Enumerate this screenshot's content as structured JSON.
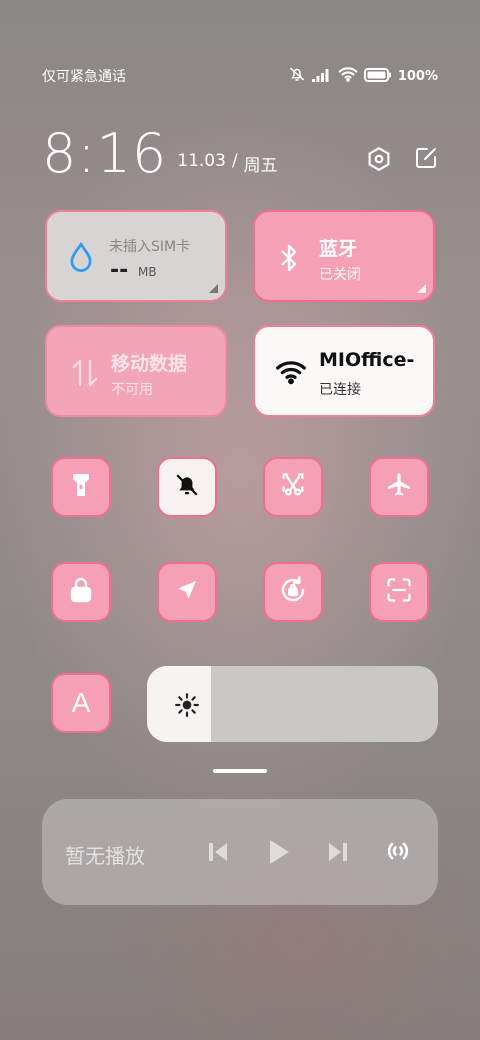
{
  "status_bar": {
    "carrier": "仅可紧急通话",
    "battery": "100%",
    "icons": [
      "mute-icon",
      "signal-icon",
      "wifi-icon",
      "battery-icon"
    ]
  },
  "header": {
    "time": "8:16",
    "date": "11.03",
    "separator": "/",
    "weekday": "周五",
    "icons": [
      "settings-icon",
      "edit-icon"
    ]
  },
  "tiles": {
    "data_usage": {
      "title": "未插入SIM卡",
      "value": "--",
      "unit": "MB",
      "icon": "drop-icon"
    },
    "bluetooth": {
      "title": "蓝牙",
      "status": "已关闭",
      "icon": "bluetooth-icon"
    },
    "mobile_data": {
      "title": "移动数据",
      "status": "不可用",
      "icon": "data-arrows-icon"
    },
    "wifi": {
      "title": "MIOffice-",
      "status": "已连接",
      "icon": "wifi-icon"
    }
  },
  "toggles": [
    {
      "name": "flashlight",
      "icon": "flashlight-icon",
      "active": false
    },
    {
      "name": "mute",
      "icon": "bell-off-icon",
      "active": true
    },
    {
      "name": "screenshot",
      "icon": "scissors-icon",
      "active": false
    },
    {
      "name": "airplane",
      "icon": "airplane-icon",
      "active": false
    },
    {
      "name": "lock",
      "icon": "lock-icon",
      "active": false
    },
    {
      "name": "location",
      "icon": "location-icon",
      "active": false
    },
    {
      "name": "rotation-lock",
      "icon": "rotation-lock-icon",
      "active": false
    },
    {
      "name": "scanner",
      "icon": "scan-icon",
      "active": false
    }
  ],
  "auto_brightness": {
    "label": "A"
  },
  "brightness": {
    "level": 0.22,
    "icon": "sun-icon"
  },
  "media": {
    "status": "暂无播放",
    "controls": [
      "previous-icon",
      "play-icon",
      "next-icon",
      "cast-icon"
    ]
  },
  "colors": {
    "accent_pink": "#f5a0b4",
    "accent_border": "#ef6f92",
    "wifi_blue": "#2f9cf0"
  }
}
